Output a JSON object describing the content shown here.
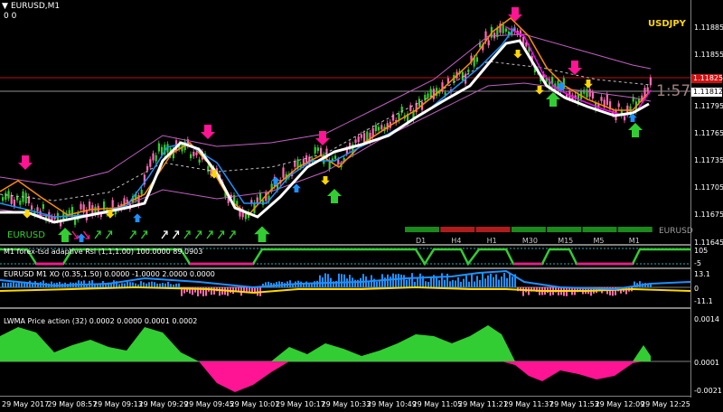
{
  "chart": {
    "symbol_title": "EURUSD,M1",
    "ohlc_line": "0 0",
    "overlay_symbol": "USDJPY",
    "bottom_left_symbol": "EURUSD",
    "bottom_right_symbol": "EURUSD",
    "countdown": "1:57",
    "current_price_red": "1.11825",
    "current_price_box": "1.11812",
    "price_ticks": [
      "1.11885",
      "1.11855",
      "1.11825",
      "1.11795",
      "1.11765",
      "1.11735",
      "1.11705",
      "1.11675",
      "1.11645"
    ],
    "timeframes": [
      {
        "label": "D1",
        "color": "#1a8a1a"
      },
      {
        "label": "H4",
        "color": "#b01c1c"
      },
      {
        "label": "H1",
        "color": "#b01c1c"
      },
      {
        "label": "M30",
        "color": "#1a8a1a"
      },
      {
        "label": "M15",
        "color": "#1a8a1a"
      },
      {
        "label": "M5",
        "color": "#1a8a1a"
      },
      {
        "label": "M1",
        "color": "#1a8a1a"
      }
    ]
  },
  "indicators": {
    "rsi": {
      "title": "M1 forex-tsd adaptive Rsi (1,1,1.00) 100.0000 89.0903",
      "ticks": [
        "105",
        "-5"
      ]
    },
    "xo": {
      "title": "EURUSD M1 XO (0.35,1.50) 0.0000 -1.0000 2.0000 0.0000",
      "ticks": [
        "13.1",
        "0",
        "-11.1"
      ]
    },
    "lwma": {
      "title": "LWMA Price action (32) 0.0002 0.0000 0.0001 0.0002",
      "ticks": [
        "0.0014",
        "0.0001",
        "-0.0021"
      ]
    }
  },
  "time_axis": [
    "29 May 2017",
    "29 May 08:57",
    "29 May 09:13",
    "29 May 09:29",
    "29 May 09:45",
    "29 May 10:01",
    "29 May 10:17",
    "29 May 10:33",
    "29 May 10:49",
    "29 May 11:05",
    "29 May 11:21",
    "29 May 11:37",
    "29 May 11:53",
    "29 May 12:09",
    "29 May 12:25"
  ],
  "colors": {
    "bull_candle": "#32cd32",
    "bear_candle": "#ff69b4",
    "ma_white": "#ffffff",
    "ma_orange": "#ff8c00",
    "ma_magenta": "#ff00ff",
    "ma_cyan": "#1e90ff",
    "envelope": "#c060c0",
    "arrow_down": "#ff1493",
    "arrow_up": "#32cd32",
    "signal_yellow": "#ffd700",
    "signal_cyan": "#1e90ff"
  },
  "icons": [
    "menu-triangle-icon",
    "down-arrow-icon",
    "up-arrow-icon"
  ]
}
